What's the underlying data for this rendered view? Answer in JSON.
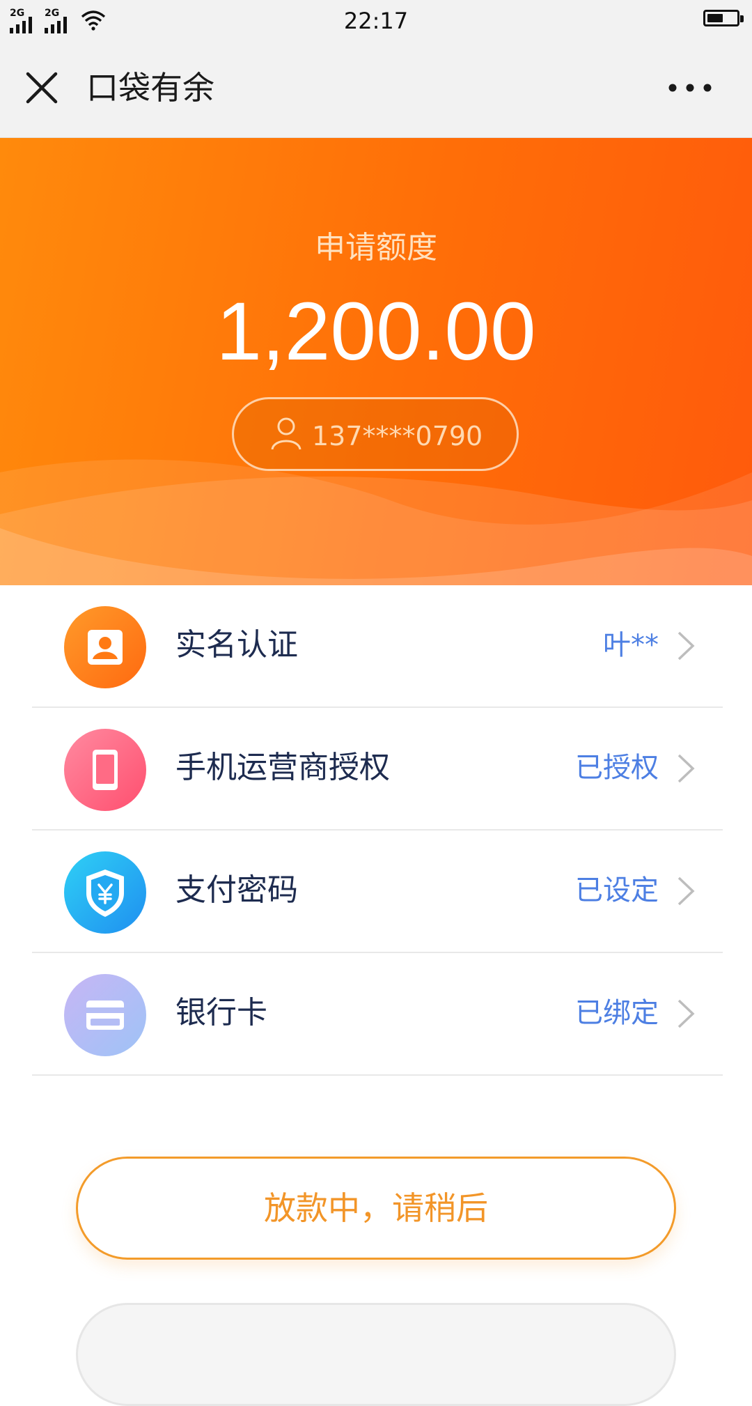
{
  "status_bar": {
    "signal_1_label": "2G",
    "signal_2_label": "2G",
    "time": "22:17",
    "battery_level": 0.55
  },
  "nav": {
    "title": "口袋有余"
  },
  "hero": {
    "label": "申请额度",
    "amount": "1,200.00",
    "phone": "137****0790"
  },
  "items": [
    {
      "label": "实名认证",
      "status": "叶**",
      "icon": "id-card-icon",
      "color": "#ff7a14"
    },
    {
      "label": "手机运营商授权",
      "status": "已授权",
      "icon": "mobile-phone-icon",
      "color": "#ff6b85"
    },
    {
      "label": "支付密码",
      "status": "已设定",
      "icon": "yuan-shield-icon",
      "color": "#23a9f2"
    },
    {
      "label": "银行卡",
      "status": "已绑定",
      "icon": "bank-card-icon",
      "color": "#a9b4f5"
    }
  ],
  "actions": {
    "primary_label": "放款中，请稍后"
  },
  "colors": {
    "hero_start": "#ff8a0c",
    "hero_end": "#ff5a0c",
    "status_blue": "#4d7fe3",
    "button_orange": "#f29528"
  }
}
